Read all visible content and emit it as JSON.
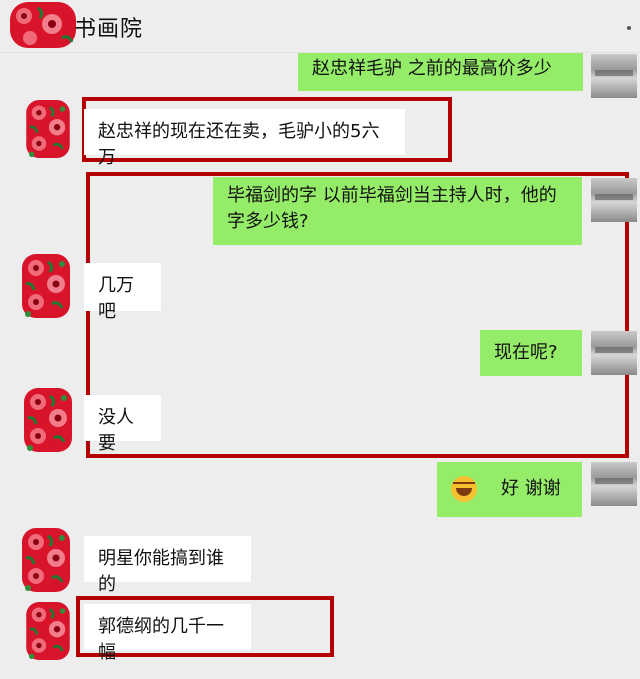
{
  "header": {
    "title": "书画院"
  },
  "messages": [
    {
      "side": "right",
      "text": "赵忠祥毛驴  之前的最高价多少"
    },
    {
      "side": "left",
      "text": "赵忠祥的现在还在卖，毛驴小的5六万"
    },
    {
      "side": "right",
      "text": "毕福剑的字  以前毕福剑当主持人时，他的字多少钱?"
    },
    {
      "side": "left",
      "text": "几万吧"
    },
    {
      "side": "right",
      "text": "现在呢?"
    },
    {
      "side": "left",
      "text": "没人要"
    },
    {
      "side": "right",
      "text": "好  谢谢",
      "emoji": "laughing-tears-emoji"
    },
    {
      "side": "left",
      "text": "明星你能搞到谁的"
    },
    {
      "side": "left",
      "text": "郭德纲的几千一幅"
    }
  ],
  "colors": {
    "background": "#ededed",
    "self_bubble": "#95ec69",
    "other_bubble": "#ffffff",
    "highlight_box": "#b30000"
  }
}
